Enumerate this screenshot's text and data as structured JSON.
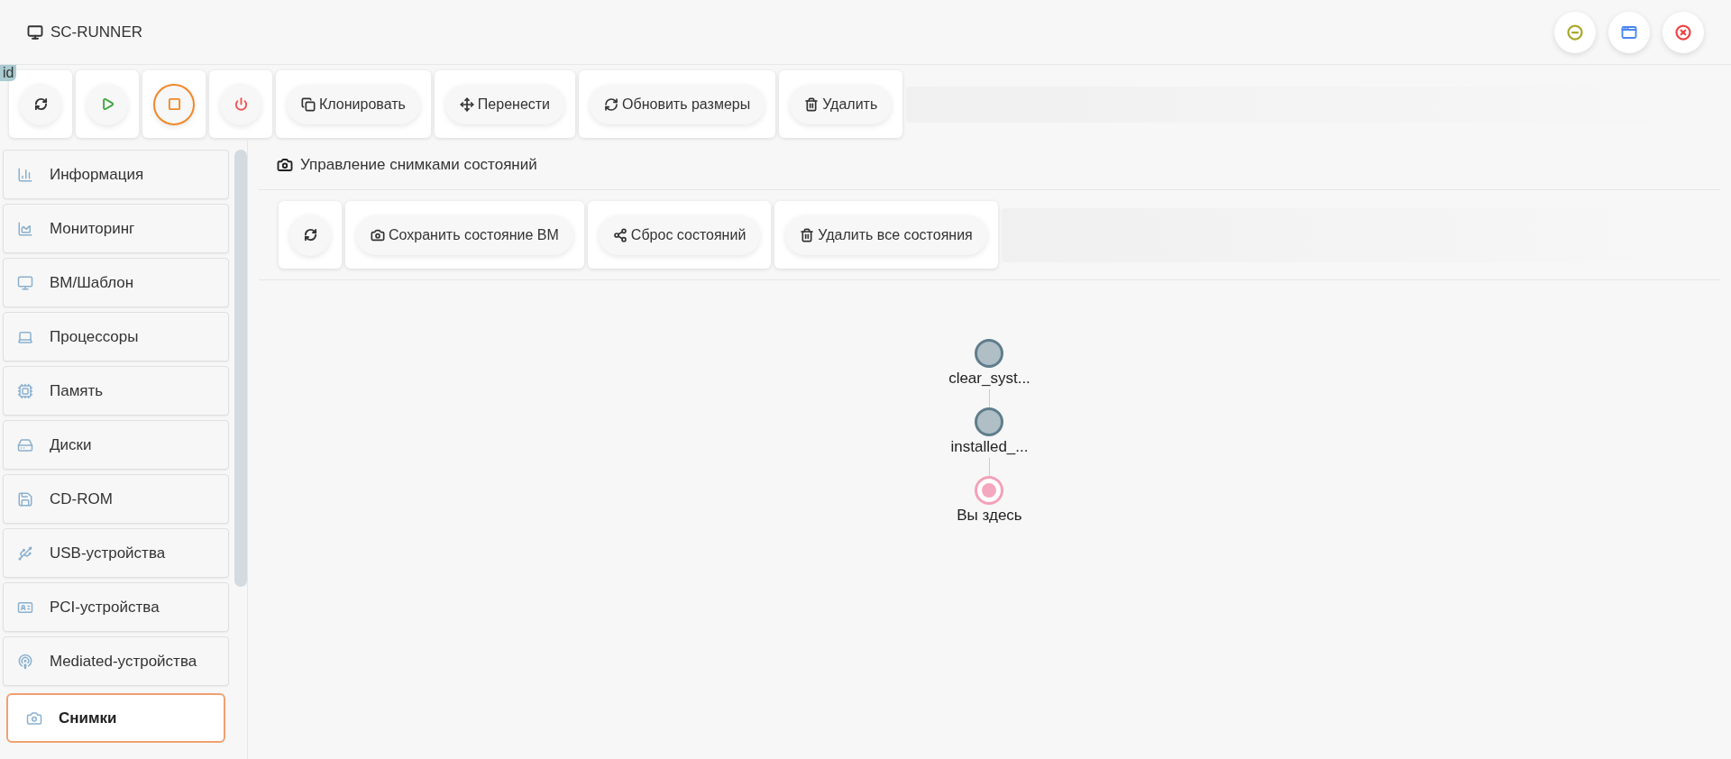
{
  "window": {
    "title": "SC-RUNNER",
    "badge": "id"
  },
  "toolbar": [
    {
      "kind": "refresh",
      "highlighted": false
    },
    {
      "kind": "start",
      "highlighted": false
    },
    {
      "kind": "stop",
      "highlighted": true
    },
    {
      "kind": "power",
      "highlighted": false
    },
    {
      "kind": "clone",
      "label": "Клонировать",
      "highlighted": false
    },
    {
      "kind": "move",
      "label": "Перенести",
      "highlighted": false
    },
    {
      "kind": "resize",
      "label": "Обновить размеры",
      "highlighted": false
    },
    {
      "kind": "delete",
      "label": "Удалить",
      "highlighted": false
    }
  ],
  "sidebar": {
    "items": [
      {
        "label": "Информация",
        "selected": false
      },
      {
        "label": "Мониторинг",
        "selected": false
      },
      {
        "label": "ВМ/Шаблон",
        "selected": false
      },
      {
        "label": "Процессоры",
        "selected": false
      },
      {
        "label": "Память",
        "selected": false
      },
      {
        "label": "Диски",
        "selected": false
      },
      {
        "label": "CD-ROM",
        "selected": false
      },
      {
        "label": "USB-устройства",
        "selected": false
      },
      {
        "label": "PCI-устройства",
        "selected": false
      },
      {
        "label": "Mediated-устройства",
        "selected": false
      },
      {
        "label": "Снимки",
        "selected": true
      }
    ]
  },
  "panel": {
    "title": "Управление снимками состояний",
    "toolbar": [
      {
        "kind": "refresh"
      },
      {
        "kind": "save",
        "label": "Сохранить состояние ВМ"
      },
      {
        "kind": "reset",
        "label": "Сброс состояний"
      },
      {
        "kind": "delete",
        "label": "Удалить все состояния"
      }
    ],
    "tree": [
      {
        "kind": "snapshot",
        "label": "clear_syst..."
      },
      {
        "kind": "snapshot",
        "label": "installed_..."
      },
      {
        "kind": "current",
        "label": "Вы здесь"
      }
    ]
  }
}
